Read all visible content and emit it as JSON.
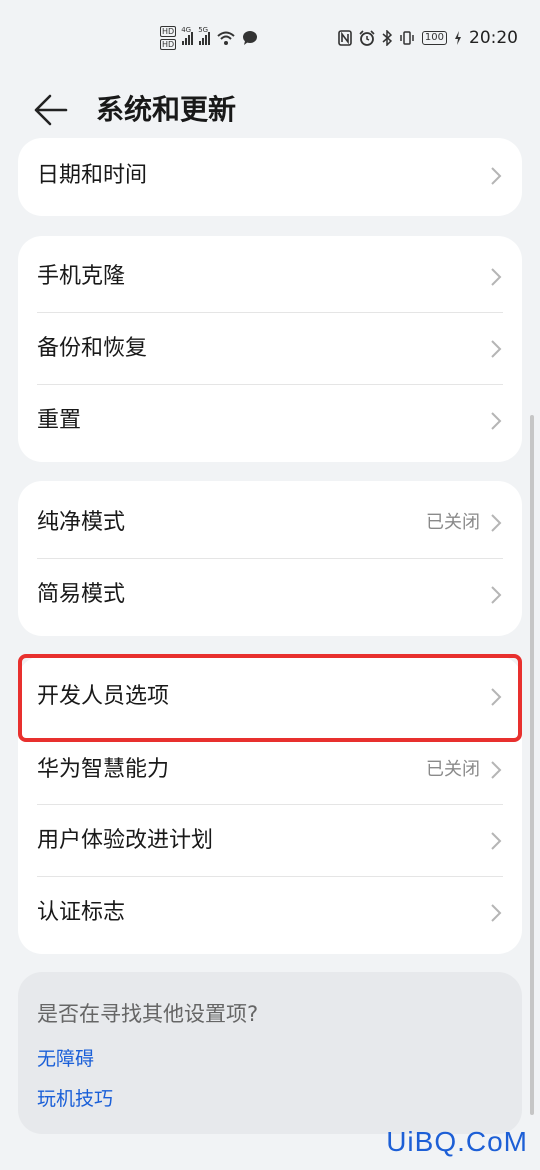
{
  "status_bar": {
    "left_labels": [
      "HD",
      "HD",
      "4G",
      "5G"
    ],
    "battery": "100",
    "time": "20:20"
  },
  "header": {
    "title": "系统和更新"
  },
  "groups": [
    {
      "items": [
        {
          "label": "日期和时间",
          "value": ""
        }
      ]
    },
    {
      "items": [
        {
          "label": "手机克隆",
          "value": ""
        },
        {
          "label": "备份和恢复",
          "value": ""
        },
        {
          "label": "重置",
          "value": ""
        }
      ]
    },
    {
      "items": [
        {
          "label": "纯净模式",
          "value": "已关闭"
        },
        {
          "label": "简易模式",
          "value": ""
        }
      ]
    },
    {
      "items": [
        {
          "label": "开发人员选项",
          "value": ""
        },
        {
          "label": "华为智慧能力",
          "value": "已关闭"
        },
        {
          "label": "用户体验改进计划",
          "value": ""
        },
        {
          "label": "认证标志",
          "value": ""
        }
      ]
    }
  ],
  "suggestions": {
    "title": "是否在寻找其他设置项?",
    "links": [
      "无障碍",
      "玩机技巧"
    ]
  },
  "watermark": "UiBQ.CoM",
  "colors": {
    "background": "#f1f3f5",
    "card": "#ffffff",
    "link": "#1a5fd8",
    "highlight": "#e8302e"
  }
}
